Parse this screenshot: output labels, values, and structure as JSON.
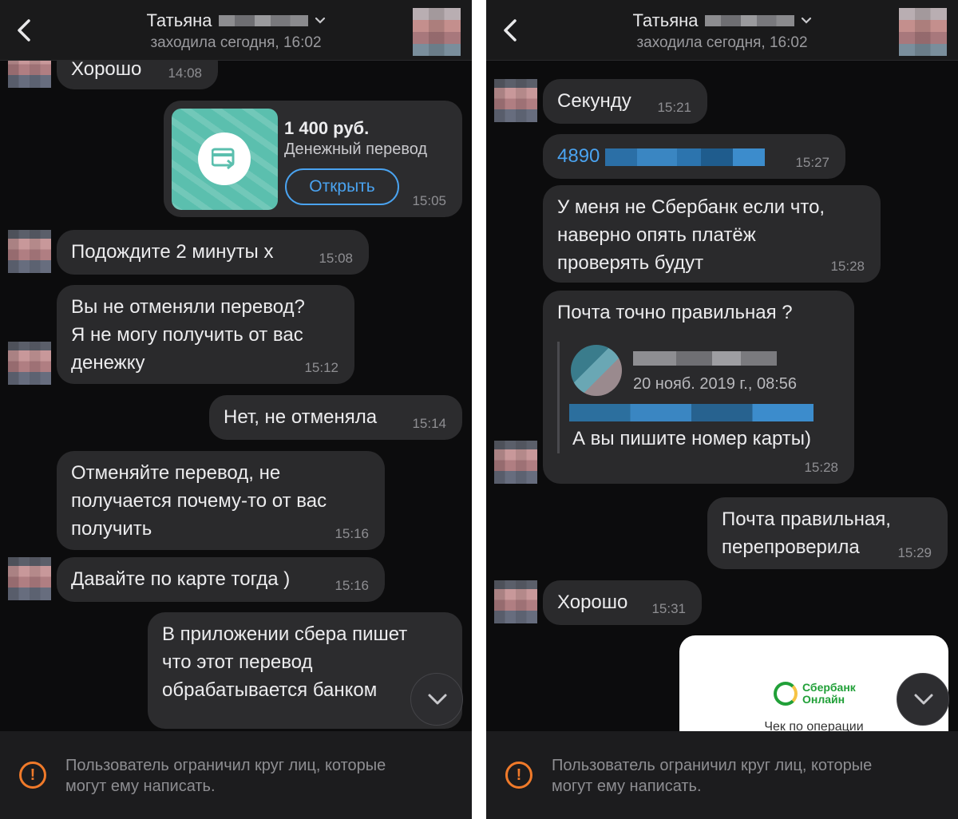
{
  "header": {
    "name": "Татьяна",
    "status": "заходила сегодня, 16:02"
  },
  "left": {
    "messages": [
      {
        "text": "Хорошо",
        "time": "14:08"
      },
      {
        "text": "Подождите 2 минуты х",
        "time": "15:08"
      },
      {
        "text": "Вы не отменяли перевод?\nЯ не могу получить от вас\nденежку",
        "time": "15:12"
      },
      {
        "text": "Нет, не отменяла",
        "time": "15:14"
      },
      {
        "text": "Отменяйте перевод, не\nполучается почему-то от вас\nполучить",
        "time": "15:16"
      },
      {
        "text": "Давайте по карте тогда )",
        "time": "15:16"
      },
      {
        "text": "В приложении сбера пишет\nчто этот перевод\nобрабатывается банком",
        "time": ""
      }
    ],
    "transfer": {
      "amount": "1 400 руб.",
      "label": "Денежный перевод",
      "button": "Открыть",
      "time": "15:05"
    }
  },
  "right": {
    "messages": [
      {
        "text": "Секунду",
        "time": "15:21"
      },
      {
        "text": "4890",
        "time": "15:27"
      },
      {
        "text": "У меня не Сбербанк если что,\nнаверно опять платёж\nпроверять будут",
        "time": "15:28"
      },
      {
        "text": "Почта точно правильная ?",
        "time": "15:28"
      },
      {
        "text": "Почта правильная,\nперепроверила",
        "time": "15:29"
      },
      {
        "text": "Хорошо",
        "time": "15:31"
      }
    ],
    "quote": {
      "date": "20 нояб. 2019 г., 08:56",
      "text": "А вы пишите номер карты)"
    },
    "receipt": {
      "brand": "Сбербанк\nОнлайн",
      "caption": "Чек по операции"
    }
  },
  "footer": {
    "notice": "Пользователь ограничил круг лиц, которые\nмогут ему написать."
  },
  "colors": {
    "background": "#0c0c0d",
    "bubble": "#2a2a2c",
    "accent": "#4aa3f0",
    "warning": "#f07a2a",
    "money": "#5bbfae",
    "sber": "#21a038"
  },
  "icons": [
    "back-arrow-icon",
    "chevron-down-icon",
    "card-transfer-icon",
    "warning-icon",
    "scroll-down-icon"
  ]
}
